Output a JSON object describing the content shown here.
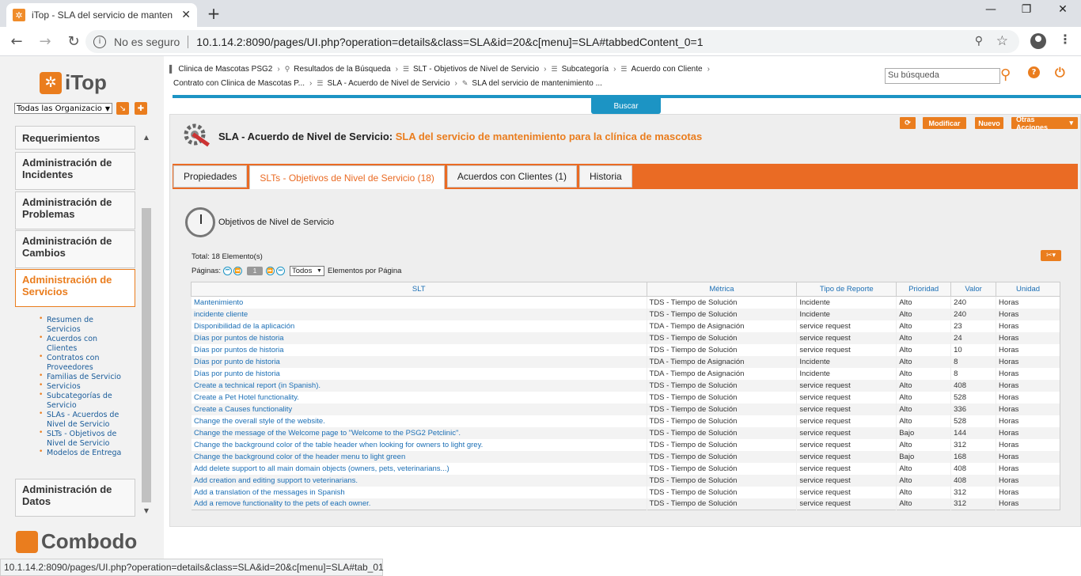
{
  "browser": {
    "tab_title": "iTop - SLA del servicio de manten",
    "security_label": "No es seguro",
    "url": "10.1.14.2:8090/pages/UI.php?operation=details&class=SLA&id=20&c[menu]=SLA#tabbedContent_0=1",
    "status_url": "10.1.14.2:8090/pages/UI.php?operation=details&class=SLA&id=20&c[menu]=SLA#tab_01"
  },
  "sidebar": {
    "logo_text": "iTop",
    "org_select": "Todas las Organizacio",
    "menus": [
      {
        "label": "Requerimientos"
      },
      {
        "label": "Administración de Incidentes"
      },
      {
        "label": "Administración de Problemas"
      },
      {
        "label": "Administración de Cambios"
      },
      {
        "label": "Administración de Servicios"
      },
      {
        "label": "Administración de Datos"
      }
    ],
    "submenu": [
      "Resumen de Servicios",
      "Acuerdos con Clientes",
      "Contratos con Proveedores",
      "Familias de Servicio",
      "Servicios",
      "Subcategorías de Servicio",
      "SLAs - Acuerdos de Nivel de Servicio",
      "SLTs - Objetivos de Nivel de Servicio",
      "Modelos de Entrega"
    ],
    "footer_logo": "Combodo"
  },
  "breadcrumbs": {
    "row1": [
      "Clinica de Mascotas PSG2",
      "Resultados de la Búsqueda",
      "SLT - Objetivos de Nivel de Servicio",
      "Subcategoría",
      "Acuerdo con Cliente"
    ],
    "row2": [
      "Contrato con Clinica de Mascotas P...",
      "SLA - Acuerdo de Nivel de Servicio",
      "SLA del servicio de mantenimiento ..."
    ]
  },
  "search": {
    "placeholder": "Su búsqueda"
  },
  "buscar_label": "Buscar",
  "toolbar": {
    "modificar": "Modificar",
    "nuevo": "Nuevo",
    "otras": "Otras Acciones"
  },
  "page": {
    "class_label": "SLA - Acuerdo de Nivel de Servicio:",
    "object_name": "SLA del servicio de mantenimiento para la clínica de mascotas"
  },
  "tabs": [
    {
      "label": "Propiedades"
    },
    {
      "label": "SLTs - Objetivos de Nivel de Servicio (18)"
    },
    {
      "label": "Acuerdos con Clientes (1)"
    },
    {
      "label": "Historia"
    }
  ],
  "section_title": "Objetivos de Nivel de Servicio",
  "total_label": "Total: 18 Elemento(s)",
  "pager": {
    "label": "Páginas:",
    "current": "1",
    "per_page_value": "Todos",
    "per_page_label": "Elementos por Página"
  },
  "table": {
    "headers": [
      "SLT",
      "Métrica",
      "Tipo de Reporte",
      "Prioridad",
      "Valor",
      "Unidad"
    ],
    "rows": [
      [
        "Mantenimiento",
        "TDS - Tiempo de Solución",
        "Incidente",
        "Alto",
        "240",
        "Horas"
      ],
      [
        "incidente cliente",
        "TDS - Tiempo de Solución",
        "Incidente",
        "Alto",
        "240",
        "Horas"
      ],
      [
        "Disponibilidad de la aplicación",
        "TDA - Tiempo de Asignación",
        "service request",
        "Alto",
        "23",
        "Horas"
      ],
      [
        "Días por puntos de historia",
        "TDS - Tiempo de Solución",
        "service request",
        "Alto",
        "24",
        "Horas"
      ],
      [
        "Días por puntos de historia",
        "TDS - Tiempo de Solución",
        "service request",
        "Alto",
        "10",
        "Horas"
      ],
      [
        "Días por punto de historia",
        "TDA - Tiempo de Asignación",
        "Incidente",
        "Alto",
        "8",
        "Horas"
      ],
      [
        "Días por punto de historia",
        "TDA - Tiempo de Asignación",
        "Incidente",
        "Alto",
        "8",
        "Horas"
      ],
      [
        "Create a technical report (in Spanish).",
        "TDS - Tiempo de Solución",
        "service request",
        "Alto",
        "408",
        "Horas"
      ],
      [
        "Create a Pet Hotel functionality.",
        "TDS - Tiempo de Solución",
        "service request",
        "Alto",
        "528",
        "Horas"
      ],
      [
        "Create a Causes functionality",
        "TDS - Tiempo de Solución",
        "service request",
        "Alto",
        "336",
        "Horas"
      ],
      [
        "Change the overall style of the website.",
        "TDS - Tiempo de Solución",
        "service request",
        "Alto",
        "528",
        "Horas"
      ],
      [
        "Change the message of the Welcome page to \"Welcome to the PSG2 Petclinic\".",
        "TDS - Tiempo de Solución",
        "service request",
        "Bajo",
        "144",
        "Horas"
      ],
      [
        "Change the background color of the table header when looking for owners to light grey.",
        "TDS - Tiempo de Solución",
        "service request",
        "Alto",
        "312",
        "Horas"
      ],
      [
        "Change the background color of the header menu to light green",
        "TDS - Tiempo de Solución",
        "service request",
        "Bajo",
        "168",
        "Horas"
      ],
      [
        "Add delete support to all main domain objects (owners, pets, veterinarians...)",
        "TDS - Tiempo de Solución",
        "service request",
        "Alto",
        "408",
        "Horas"
      ],
      [
        "Add creation and editing support to veterinarians.",
        "TDS - Tiempo de Solución",
        "service request",
        "Alto",
        "408",
        "Horas"
      ],
      [
        "Add a translation of the messages in Spanish",
        "TDS - Tiempo de Solución",
        "service request",
        "Alto",
        "312",
        "Horas"
      ],
      [
        "Add a remove functionality to the pets of each owner.",
        "TDS - Tiempo de Solución",
        "service request",
        "Alto",
        "312",
        "Horas"
      ]
    ]
  }
}
